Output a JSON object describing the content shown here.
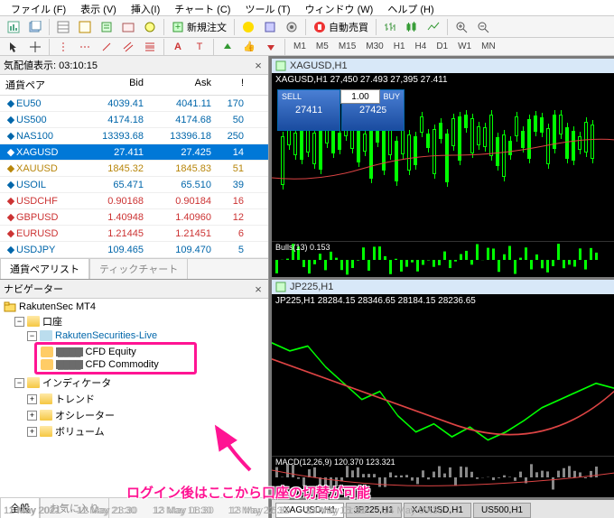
{
  "menu": [
    "ファイル (F)",
    "表示 (V)",
    "挿入(I)",
    "チャート (C)",
    "ツール (T)",
    "ウィンドウ (W)",
    "ヘルプ (H)"
  ],
  "toolbar": {
    "new_order": "新規注文",
    "autotrade": "自動売買"
  },
  "timeframes": [
    "M1",
    "M5",
    "M15",
    "M30",
    "H1",
    "H4",
    "D1",
    "W1",
    "MN"
  ],
  "market_watch": {
    "title": "気配値表示: 03:10:15",
    "cols": [
      "通貨ペア",
      "Bid",
      "Ask",
      "!"
    ],
    "rows": [
      {
        "sym": "EU50",
        "bid": "4039.41",
        "ask": "4041.11",
        "ex": "170",
        "dir": "up"
      },
      {
        "sym": "US500",
        "bid": "4174.18",
        "ask": "4174.68",
        "ex": "50",
        "dir": "up"
      },
      {
        "sym": "NAS100",
        "bid": "13393.68",
        "ask": "13396.18",
        "ex": "250",
        "dir": "up"
      },
      {
        "sym": "XAGUSD",
        "bid": "27.411",
        "ask": "27.425",
        "ex": "14",
        "dir": "sel"
      },
      {
        "sym": "XAUUSD",
        "bid": "1845.32",
        "ask": "1845.83",
        "ex": "51",
        "dir": "gold"
      },
      {
        "sym": "USOIL",
        "bid": "65.471",
        "ask": "65.510",
        "ex": "39",
        "dir": "up"
      },
      {
        "sym": "USDCHF",
        "bid": "0.90168",
        "ask": "0.90184",
        "ex": "16",
        "dir": "down"
      },
      {
        "sym": "GBPUSD",
        "bid": "1.40948",
        "ask": "1.40960",
        "ex": "12",
        "dir": "down"
      },
      {
        "sym": "EURUSD",
        "bid": "1.21445",
        "ask": "1.21451",
        "ex": "6",
        "dir": "down"
      },
      {
        "sym": "USDJPY",
        "bid": "109.465",
        "ask": "109.470",
        "ex": "5",
        "dir": "up"
      }
    ],
    "tabs": [
      "通貨ペアリスト",
      "ティックチャート"
    ]
  },
  "navigator": {
    "title": "ナビゲーター",
    "root": "RakutenSec MT4",
    "accounts": "口座",
    "server": "RakutenSecurities-Live",
    "acc1": "CFD Equity",
    "acc2": "CFD Commodity",
    "indicators": "インディケータ",
    "sub": [
      "トレンド",
      "オシレーター",
      "ボリューム"
    ],
    "tabs": [
      "全般",
      "お気に入り"
    ]
  },
  "charts": {
    "top": {
      "title": "XAGUSD,H1",
      "info": "XAGUSD,H1 27,450 27.493 27,395 27.411",
      "sell": {
        "label": "SELL",
        "pre": "27",
        "big": "41",
        "sup": "1"
      },
      "buy": {
        "label": "BUY",
        "pre": "27",
        "big": "42",
        "sup": "5"
      },
      "vol": "1.00",
      "indicator": "Bulls(13) 0.153",
      "xaxis": [
        "12 May 2021",
        "12 May 23:30",
        "13 May 08:30",
        "13 May 16:30",
        "14 May 01:30",
        "14 May 09:30"
      ]
    },
    "bottom": {
      "title": "JP225,H1",
      "info": "JP225,H1 28284.15 28346.65 28184.15 28236.65",
      "indicator": "MACD(12,26,9) 120.370 123.321",
      "xaxis": [
        "11 May 2021",
        "11 May 21:30",
        "12 May 11:30",
        "12 May 22:30",
        "13 May 15:30"
      ]
    },
    "tabs": [
      "XAGUSD,H1",
      "JP225,H1",
      "XAUUSD,H1",
      "US500,H1"
    ]
  },
  "annotation": "ログイン後はここから口座の切替が可能"
}
